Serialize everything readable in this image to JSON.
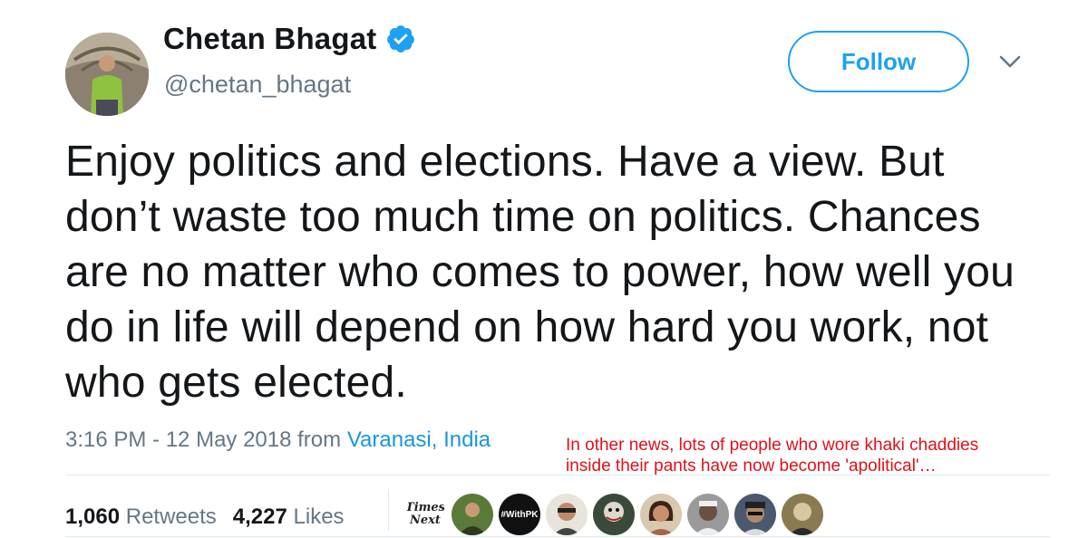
{
  "author": {
    "display_name": "Chetan Bhagat",
    "handle": "@chetan_bhagat",
    "verified_icon": "verified-badge-icon"
  },
  "follow_label": "Follow",
  "menu_icon": "chevron-down-icon",
  "tweet": {
    "text": "Enjoy politics and elections. Have a view. But don’t waste too much time on politics. Chances are no matter who comes to power, how well you do in life will depend on how hard you work, not who gets elected."
  },
  "meta": {
    "time": "3:16 PM - 12 May 2018 from ",
    "location": "Varanasi, India"
  },
  "overlay_note": {
    "line1": "In other news, lots of people who wore khaki chaddies",
    "line2": "inside their pants have now become 'apolitical'…"
  },
  "stats": {
    "retweets_count": "1,060",
    "retweets_label": "Retweets",
    "likes_count": "4,227",
    "likes_label": "Likes"
  },
  "likers": [
    {
      "kind": "logo",
      "line1": "Times",
      "line2": "Next"
    },
    {
      "kind": "avatar",
      "color": "#5a7a3a"
    },
    {
      "kind": "hashtag",
      "label": "#WithPK"
    },
    {
      "kind": "avatar",
      "color": "#c08a6a"
    },
    {
      "kind": "avatar",
      "color": "#3a4a3a"
    },
    {
      "kind": "avatar",
      "color": "#a06848"
    },
    {
      "kind": "avatar",
      "color": "#6a6a6a"
    },
    {
      "kind": "avatar",
      "color": "#4a5870"
    },
    {
      "kind": "avatar",
      "color": "#8a7a50"
    }
  ],
  "colors": {
    "brand_blue": "#1da1f2",
    "link_blue": "#1b95e0",
    "secondary_text": "#657786",
    "overlay_red": "#e0101a"
  }
}
